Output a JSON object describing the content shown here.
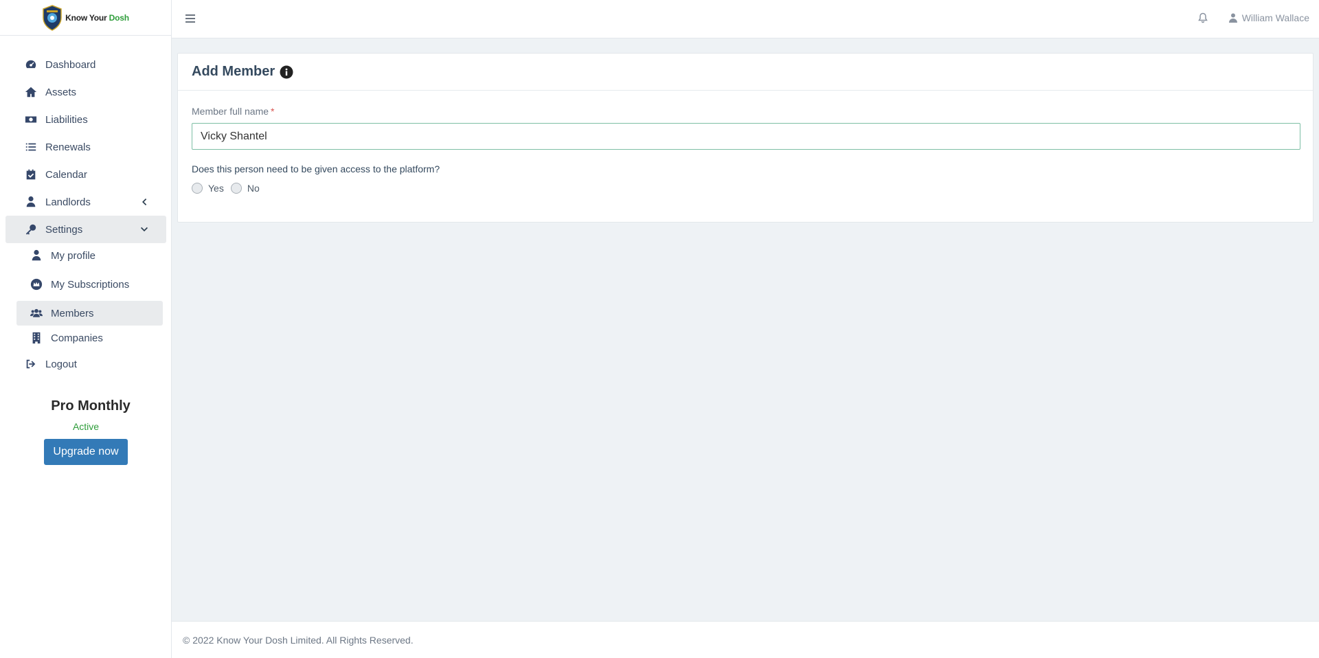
{
  "brand": {
    "name_part1": "Know Your ",
    "name_part2": "Dosh",
    "logo_icon": "shield-logo-icon"
  },
  "sidebar": {
    "items": [
      {
        "label": "Dashboard",
        "icon": "gauge-icon"
      },
      {
        "label": "Assets",
        "icon": "home-icon"
      },
      {
        "label": "Liabilities",
        "icon": "money-bill-icon"
      },
      {
        "label": "Renewals",
        "icon": "list-icon"
      },
      {
        "label": "Calendar",
        "icon": "calendar-check-icon"
      },
      {
        "label": "Landlords",
        "icon": "user-tie-icon"
      },
      {
        "label": "Settings",
        "icon": "key-icon"
      }
    ],
    "settings_sub": [
      {
        "label": "My profile",
        "icon": "user-icon"
      },
      {
        "label": "My Subscriptions",
        "icon": "crown-icon"
      },
      {
        "label": "Members",
        "icon": "users-icon"
      },
      {
        "label": "Companies",
        "icon": "building-icon"
      }
    ],
    "logout": {
      "label": "Logout",
      "icon": "sign-out-icon"
    }
  },
  "plan": {
    "name": "Pro Monthly",
    "status": "Active",
    "upgrade_label": "Upgrade now"
  },
  "topbar": {
    "user_name": "William Wallace"
  },
  "card": {
    "title": "Add Member",
    "name_label": "Member full name",
    "required_mark": "*",
    "name_value": "Vicky Shantel",
    "access_question": "Does this person need to be given access to the platform?",
    "options": [
      "Yes",
      "No"
    ]
  },
  "footer": {
    "copyright": "© 2022 Know Your Dosh Limited. All Rights Reserved."
  },
  "colors": {
    "accent": "#337ab7",
    "success": "#2e9d3a",
    "nav_icon": "#35476a",
    "background": "#eef2f5"
  }
}
